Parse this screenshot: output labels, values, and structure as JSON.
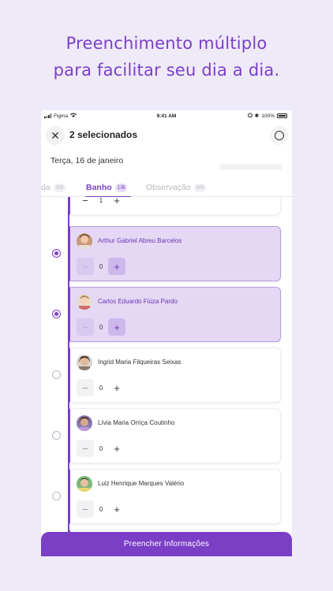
{
  "headline": {
    "line1": "Preenchimento múltiplo",
    "line2": "para facilitar seu dia a dia."
  },
  "statusbar": {
    "carrier": "Figma",
    "time": "9:41 AM",
    "battery": "100%"
  },
  "topbar": {
    "title": "2 selecionados",
    "close_icon": "close-icon",
    "select_all_icon": "circle-icon"
  },
  "date": "Terça, 16 de janeiro",
  "tabs": [
    {
      "label": "da",
      "count": "0/8",
      "active": false
    },
    {
      "label": "Banho",
      "count": "1/8",
      "active": true
    },
    {
      "label": "Observação",
      "count": "0/8",
      "active": false
    }
  ],
  "top_card": {
    "qty": "1"
  },
  "children": [
    {
      "name": "Arthur Gabriel Abreu Barcelos",
      "qty": "0",
      "selected": true
    },
    {
      "name": "Carlos Eduardo Fiúza Pardo",
      "qty": "0",
      "selected": true
    },
    {
      "name": "Ingrid Maria Filqueiras Seixas",
      "qty": "0",
      "selected": false
    },
    {
      "name": "Lívia Maria Orriça Coutinho",
      "qty": "0",
      "selected": false
    },
    {
      "name": "Luiz Henrique Marques Valério",
      "qty": "0",
      "selected": false
    }
  ],
  "stepper": {
    "minus": "−",
    "plus": "+"
  },
  "bottom_button": "Preencher Informações",
  "colors": {
    "accent": "#7b3fc6",
    "background": "#efeaf8",
    "selected_card": "#e4d8f5"
  }
}
